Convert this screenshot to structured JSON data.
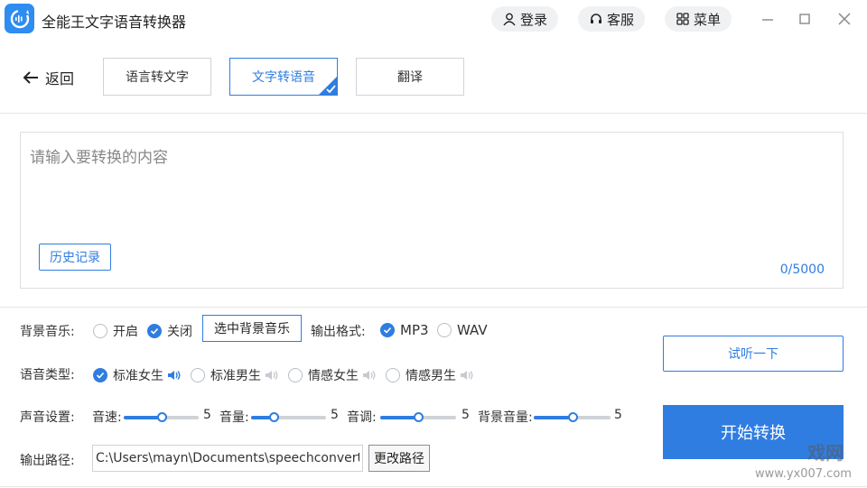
{
  "app": {
    "title": "全能王文字语音转换器"
  },
  "header": {
    "login_label": "登录",
    "service_label": "客服",
    "menu_label": "菜单"
  },
  "nav": {
    "back_label": "返回",
    "tabs": [
      {
        "label": "语言转文字",
        "active": false
      },
      {
        "label": "文字转语音",
        "active": true
      },
      {
        "label": "翻译",
        "active": false
      }
    ]
  },
  "editor": {
    "placeholder": "请输入要转换的内容",
    "history_label": "历史记录",
    "counter": "0/5000"
  },
  "settings": {
    "bgm": {
      "label": "背景音乐:",
      "options": [
        {
          "label": "开启",
          "checked": false
        },
        {
          "label": "关闭",
          "checked": true
        }
      ],
      "select_label": "选中背景音乐"
    },
    "format": {
      "label": "输出格式:",
      "options": [
        {
          "label": "MP3",
          "checked": true
        },
        {
          "label": "WAV",
          "checked": false
        }
      ]
    },
    "voice": {
      "label": "语音类型:",
      "options": [
        {
          "label": "标准女生",
          "checked": true
        },
        {
          "label": "标准男生",
          "checked": false
        },
        {
          "label": "情感女生",
          "checked": false
        },
        {
          "label": "情感男生",
          "checked": false
        }
      ]
    },
    "sound": {
      "label": "声音设置:",
      "sliders": [
        {
          "label": "音速:",
          "value": "5",
          "level": 0.5
        },
        {
          "label": "音量:",
          "value": "5",
          "level": 0.3
        },
        {
          "label": "音调:",
          "value": "5",
          "level": 0.5
        },
        {
          "label": "背景音量:",
          "value": "5",
          "level": 0.5
        }
      ]
    },
    "output": {
      "label": "输出路径:",
      "path": "C:\\Users\\mayn\\Documents\\speechconvert_w",
      "change_label": "更改路径"
    }
  },
  "actions": {
    "preview_label": "试听一下",
    "start_label": "开始转换"
  },
  "watermark": {
    "mark": "戏网",
    "url": "www.yx007.com"
  },
  "colors": {
    "accent": "#2f7de1",
    "logo": "#2f8cf0"
  }
}
